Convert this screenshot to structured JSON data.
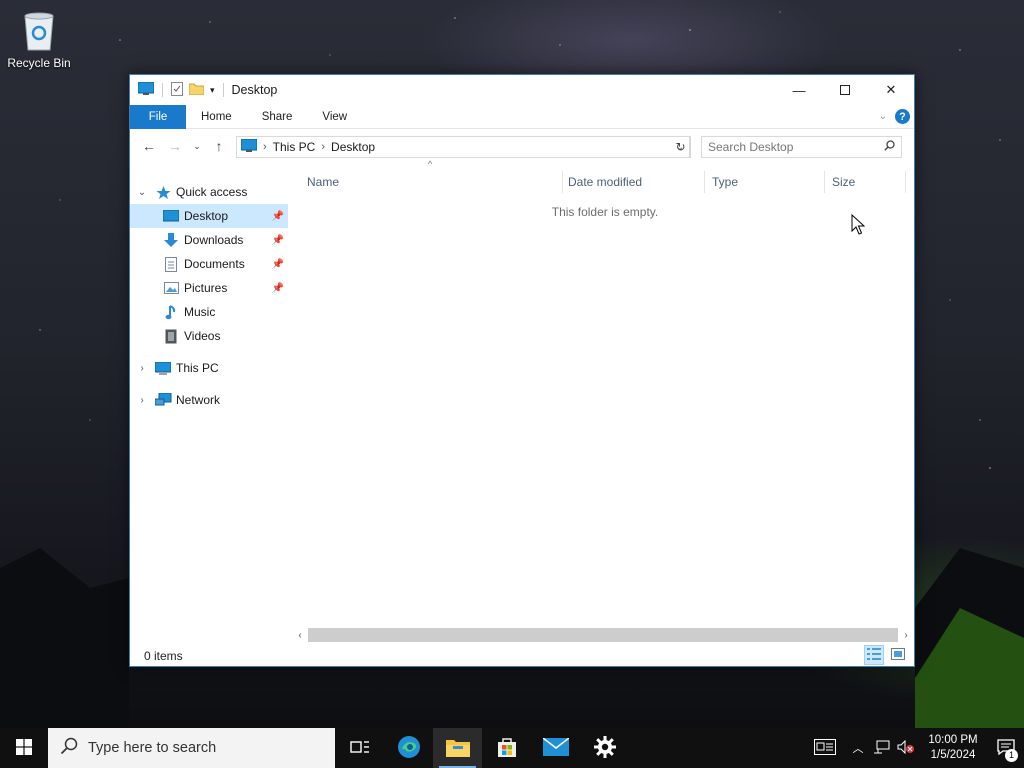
{
  "desktop": {
    "recycle_bin_label": "Recycle Bin"
  },
  "window": {
    "title": "Desktop",
    "ribbon_tabs": [
      "File",
      "Home",
      "Share",
      "View"
    ],
    "help_label": "?",
    "address": {
      "crumbs": [
        "This PC",
        "Desktop"
      ]
    },
    "search_placeholder": "Search Desktop",
    "columns": [
      "Name",
      "Date modified",
      "Type",
      "Size"
    ],
    "empty_message": "This folder is empty.",
    "status_text": "0 items",
    "nav": {
      "quick_access": "Quick access",
      "items": [
        {
          "label": "Desktop",
          "icon": "desktop-folder-icon",
          "pinned": true,
          "selected": true
        },
        {
          "label": "Downloads",
          "icon": "downloads-folder-icon",
          "pinned": true
        },
        {
          "label": "Documents",
          "icon": "documents-folder-icon",
          "pinned": true
        },
        {
          "label": "Pictures",
          "icon": "pictures-folder-icon",
          "pinned": true
        },
        {
          "label": "Music",
          "icon": "music-folder-icon",
          "pinned": false
        },
        {
          "label": "Videos",
          "icon": "videos-folder-icon",
          "pinned": false
        }
      ],
      "this_pc": "This PC",
      "network": "Network"
    }
  },
  "taskbar": {
    "search_placeholder": "Type here to search",
    "apps": [
      "task-view-icon",
      "edge-icon",
      "file-explorer-icon",
      "store-icon",
      "mail-icon",
      "settings-icon"
    ],
    "clock_time": "10:00 PM",
    "clock_date": "1/5/2024",
    "notification_count": "1"
  },
  "colors": {
    "accent": "#1979ca",
    "selection": "#cce8ff"
  }
}
